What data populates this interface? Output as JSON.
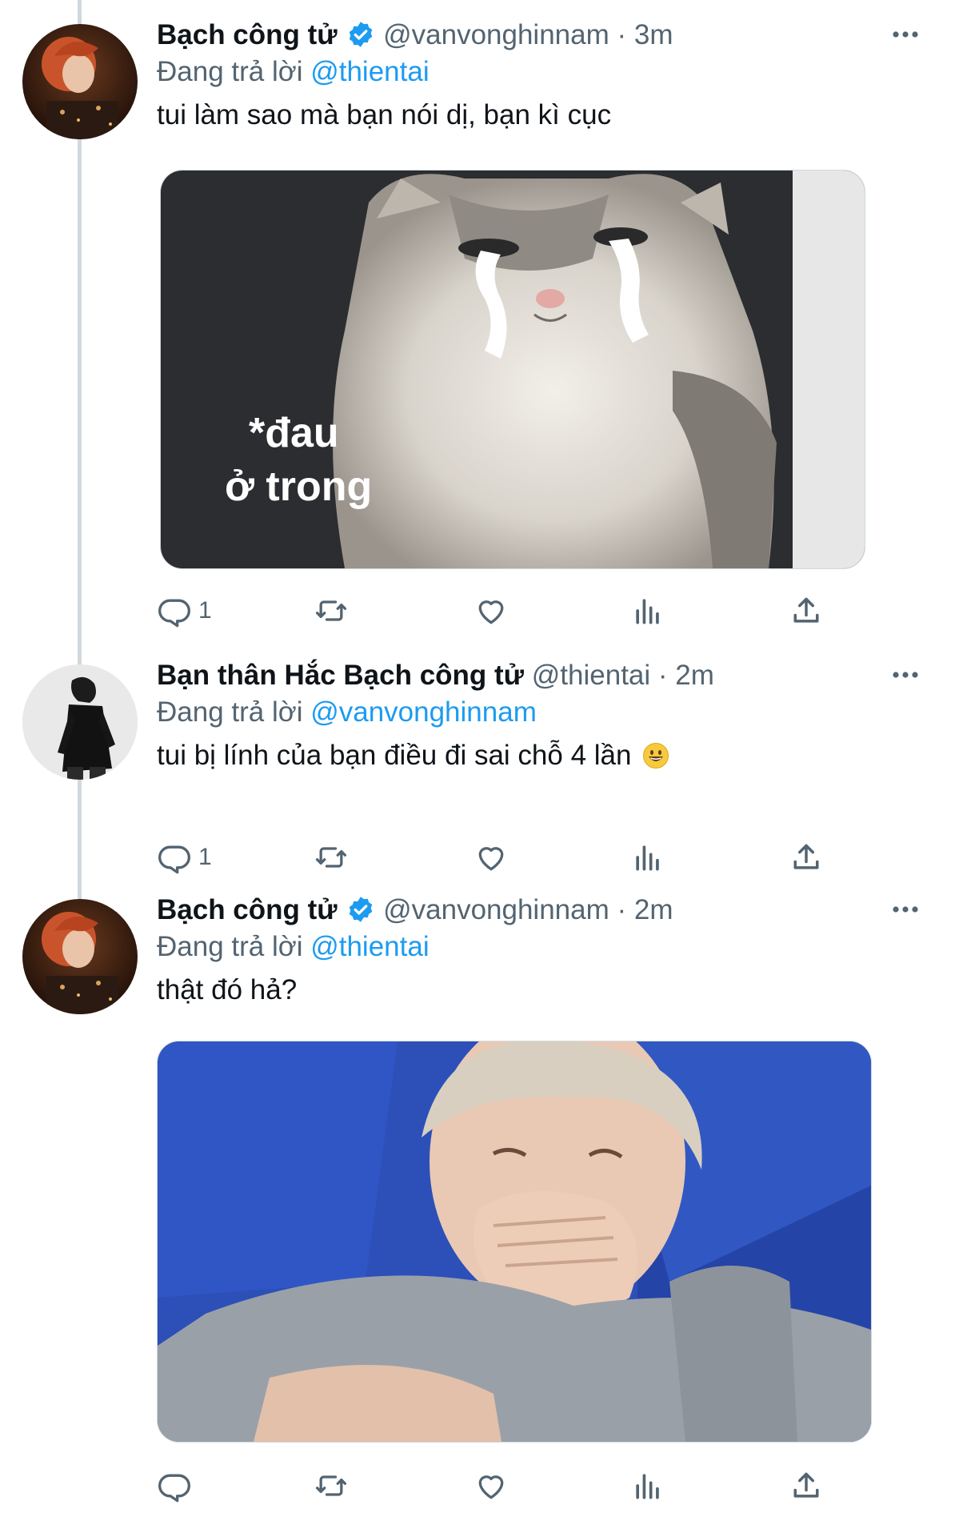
{
  "tweets": [
    {
      "name": "Bạch công tử",
      "verified": true,
      "handle": "@vanvonghinnam",
      "separator": "·",
      "time": "3m",
      "replying_prefix": "Đang trả lời",
      "replying_to": "@thientai",
      "text": "tui làm sao mà bạn nói dị, bạn kì cục",
      "media_caption_line1": "*đau",
      "media_caption_line2": "ở trong",
      "reply_count": "1"
    },
    {
      "name": "Bạn thân Hắc Bạch công tử",
      "verified": false,
      "handle": "@thientai",
      "separator": "·",
      "time": "2m",
      "replying_prefix": "Đang trả lời",
      "replying_to": "@vanvonghinnam",
      "text": "tui bị lính của bạn điều đi sai chỗ 4 lần",
      "emoji": "grinning-face-emoji",
      "reply_count": "1"
    },
    {
      "name": "Bạch công tử",
      "verified": true,
      "handle": "@vanvonghinnam",
      "separator": "·",
      "time": "2m",
      "replying_prefix": "Đang trả lời",
      "replying_to": "@thientai",
      "text": "thật đó hả?",
      "reply_count": ""
    }
  ],
  "icons": {
    "reply": "reply-icon",
    "retweet": "retweet-icon",
    "like": "like-icon",
    "views": "views-icon",
    "share": "share-icon",
    "more": "more-icon",
    "verified": "verified-badge-icon"
  },
  "colors": {
    "link": "#1d9bf0",
    "secondary_text": "#536471",
    "primary_text": "#0f1419",
    "thread_line": "#cfd9de"
  }
}
